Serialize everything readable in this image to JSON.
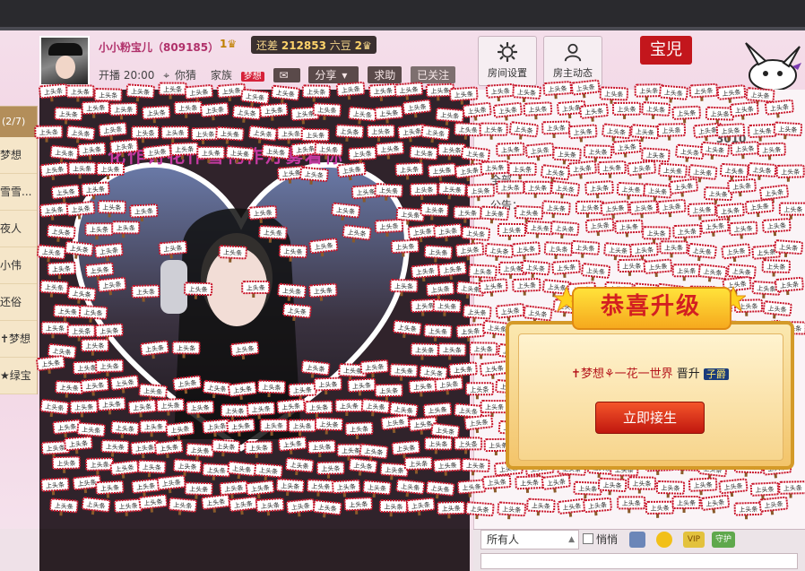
{
  "header": {
    "username": "小小粉宝儿",
    "user_id": "（809185）",
    "level_badge": "1",
    "bean_prefix": "还差",
    "bean_amount": "212853",
    "bean_suffix": "六豆",
    "bean_level": "2",
    "start_time": "开播 20:00",
    "location": "你猜",
    "family_label": "家族",
    "family_tag": "梦想",
    "share_label": "分享",
    "ask_label": "求助",
    "followed_label": "已关注"
  },
  "toolbar": {
    "room_settings": "房间设置",
    "host_feed": "房主动态"
  },
  "brand": {
    "logo_text": "宝児"
  },
  "sidebar": {
    "head": "(2/7)",
    "items": [
      "梦想",
      "雪雪...",
      "夜人",
      "小伟",
      "还俗",
      "✝梦想",
      "★绿宝"
    ]
  },
  "video": {
    "heart_caption": "化作诗花作雪花作灯雾着你"
  },
  "chat_panel": {
    "all_label": "全部",
    "notice_label": "公告：",
    "count": "3010"
  },
  "level_up": {
    "title": "恭喜升级",
    "user": "✝梦想⚘一花一世界",
    "action": "晋升",
    "rank": "子爵",
    "button": "立即接生"
  },
  "chat_bar": {
    "target": "所有人",
    "quiet": "悄悄",
    "vip": "VIP",
    "guard": "守护"
  },
  "sticker": {
    "text": "上头条"
  },
  "colors": {
    "accent_pink": "#b0306a",
    "brand_red": "#c3161c",
    "gold": "#d49a28"
  }
}
